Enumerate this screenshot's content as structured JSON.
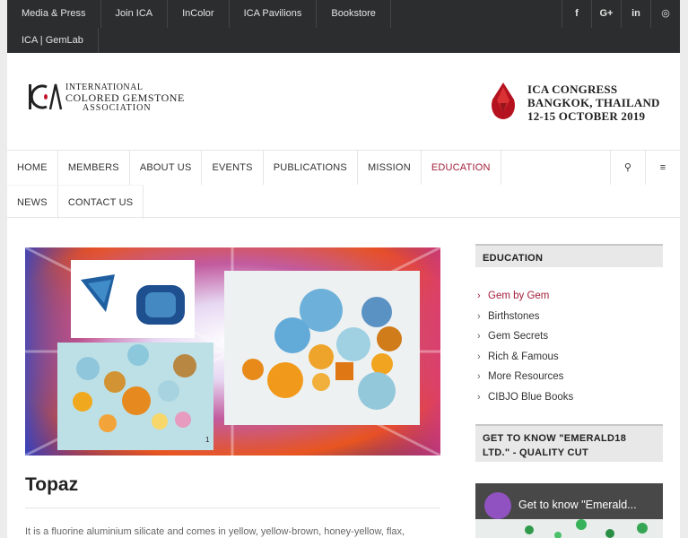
{
  "topbar": {
    "links": [
      "Media & Press",
      "Join ICA",
      "InColor",
      "ICA Pavilions",
      "Bookstore"
    ],
    "links_row2": [
      "ICA | GemLab"
    ],
    "social": [
      {
        "icon": "facebook-icon",
        "glyph": "f"
      },
      {
        "icon": "google-plus-icon",
        "glyph": "G+"
      },
      {
        "icon": "linkedin-icon",
        "glyph": "in"
      },
      {
        "icon": "instagram-icon",
        "glyph": "◎"
      }
    ]
  },
  "header": {
    "logo_line1": "INTERNATIONAL",
    "logo_line2": "COLORED GEMSTONE",
    "logo_line3": "ASSOCIATION",
    "congress_line1": "ICA CONGRESS",
    "congress_line2": "BANGKOK, THAILAND",
    "congress_line3": "12-15 OCTOBER 2019"
  },
  "nav": {
    "items": [
      "HOME",
      "MEMBERS",
      "ABOUT US",
      "EVENTS",
      "PUBLICATIONS",
      "MISSION",
      "EDUCATION"
    ],
    "items_row2": [
      "NEWS",
      "CONTACT US"
    ],
    "active": "EDUCATION",
    "search_glyph": "⚲",
    "menu_glyph": "≡"
  },
  "main": {
    "hero_number": "1",
    "title": "Topaz",
    "intro": "It is a fluorine aluminium silicate and comes in yellow, yellow-brown, honey-yellow, flax,"
  },
  "sidebar": {
    "heading1": "EDUCATION",
    "items": [
      "Gem by Gem",
      "Birthstones",
      "Gem Secrets",
      "Rich & Famous",
      "More Resources",
      "CIBJO Blue Books"
    ],
    "current": "Gem by Gem",
    "heading2": "GET TO KNOW \"EMERALD18 LTD.\" - QUALITY CUT",
    "video_title": "Get to know \"Emerald..."
  },
  "colors": {
    "accent": "#a31f3a",
    "topbar": "#2c2d2e"
  }
}
